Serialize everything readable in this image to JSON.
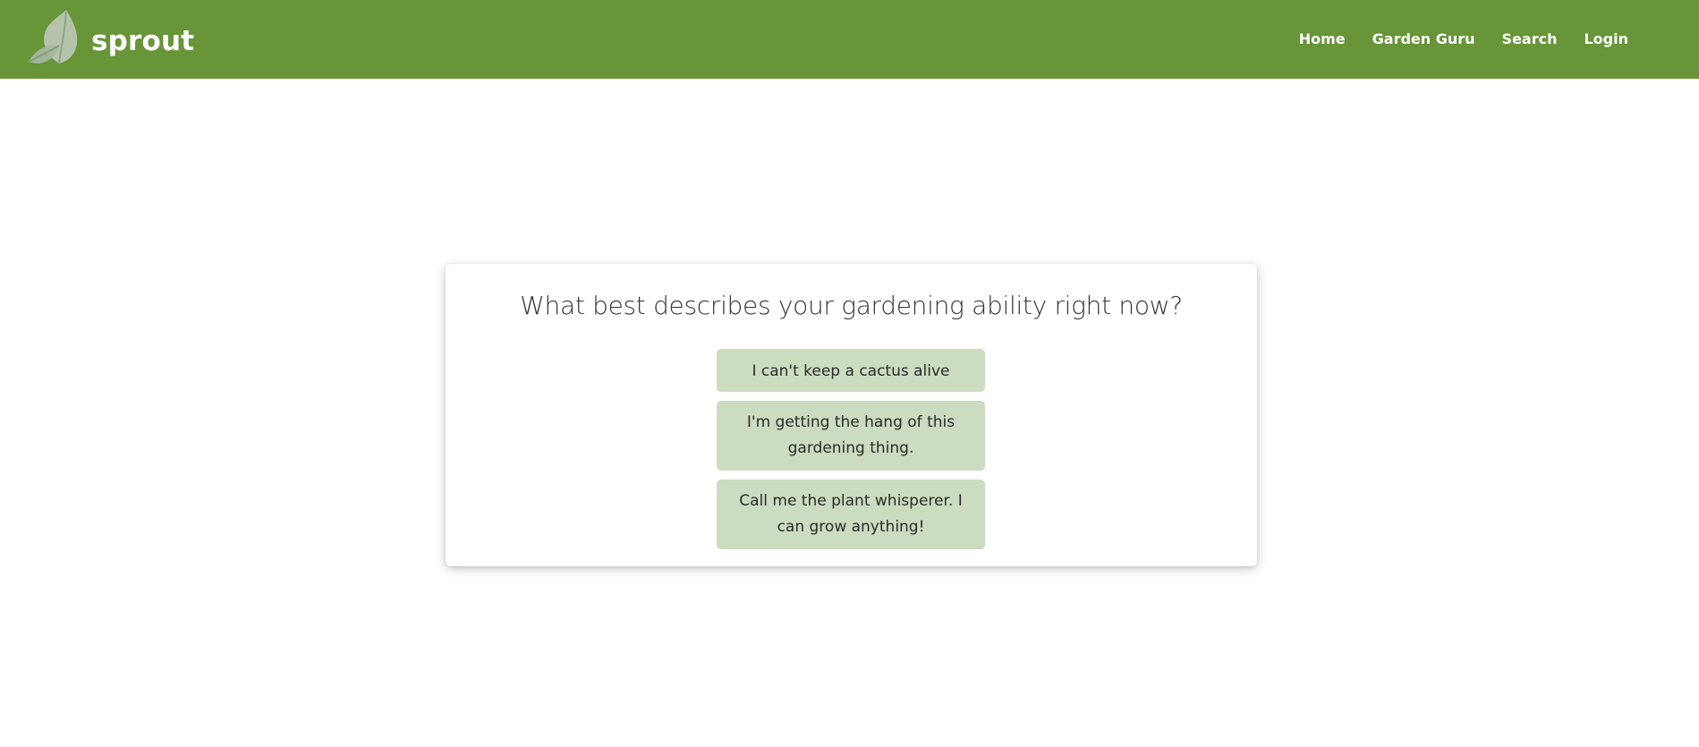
{
  "brand": {
    "name": "sprout",
    "logo_icon": "leaf-logo-icon",
    "colors": {
      "header": "#679537",
      "leaf_primary": "#bcc7b5",
      "leaf_secondary": "#a9b6a2"
    }
  },
  "nav": {
    "items": [
      {
        "label": "Home"
      },
      {
        "label": "Garden Guru"
      },
      {
        "label": "Search"
      },
      {
        "label": "Login"
      }
    ]
  },
  "quiz": {
    "question": "What best describes your gardening ability right now?",
    "options": [
      {
        "label": "I can't keep a cactus alive"
      },
      {
        "label": "I'm getting the hang of this gardening thing."
      },
      {
        "label": "Call me the plant whisperer. I can grow anything!"
      }
    ],
    "colors": {
      "option_bg": "#cbdcc0"
    }
  }
}
